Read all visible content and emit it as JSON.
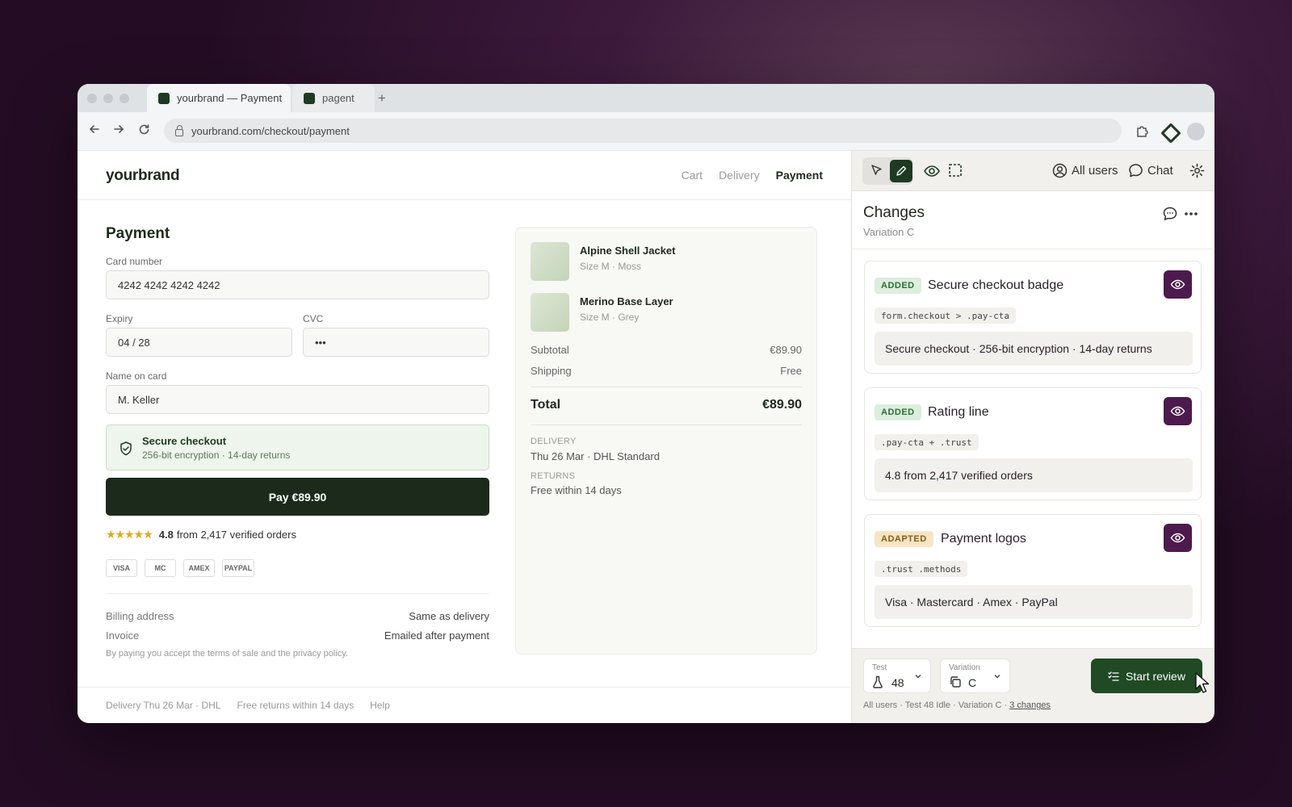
{
  "browser": {
    "tabs": [
      {
        "label": "yourbrand — Payment"
      },
      {
        "label": "pagent"
      }
    ],
    "new_tab": "+",
    "url": "yourbrand.com/checkout/payment"
  },
  "store": {
    "logo": "yourbrand",
    "steps": [
      "Cart",
      "Delivery",
      "Payment"
    ],
    "page_title": "Payment",
    "card_number_label": "Card number",
    "card_number_value": "4242 4242 4242 4242",
    "expiry_label": "Expiry",
    "expiry_value": "04 / 28",
    "cvc_label": "CVC",
    "cvc_value": "•••",
    "name_label": "Name on card",
    "name_value": "M. Keller",
    "secure_title": "Secure checkout",
    "secure_sub": "256-bit encryption · 14-day returns",
    "pay_button": "Pay €89.90",
    "rating_stars": "★★★★★",
    "rating_value": "4.8",
    "rating_text": "from 2,417 verified orders",
    "pay_logos": [
      "VISA",
      "MC",
      "AMEX",
      "PAYPAL"
    ],
    "billing_label": "Billing address",
    "billing_value": "Same as delivery",
    "invoice_label": "Invoice",
    "invoice_value": "Emailed after payment",
    "terms": "By paying you accept the terms of sale and the privacy policy.",
    "footer_links": [
      "Delivery Thu 26 Mar · DHL",
      "Free returns within 14 days",
      "Help"
    ]
  },
  "summary": {
    "items": [
      {
        "name": "Alpine Shell Jacket",
        "sub": "Size M · Moss"
      },
      {
        "name": "Merino Base Layer",
        "sub": "Size M · Grey"
      }
    ],
    "subtotal_label": "Subtotal",
    "subtotal_value": "€89.90",
    "shipping_label": "Shipping",
    "shipping_value": "Free",
    "total_label": "Total",
    "total_value": "€89.90",
    "delivery_cap": "DELIVERY",
    "delivery_value": "Thu 26 Mar · DHL Standard",
    "returns_cap": "RETURNS",
    "returns_value": "Free within 14 days"
  },
  "panel": {
    "audience": "All users",
    "chat": "Chat",
    "title": "Changes",
    "subtitle": "Variation C",
    "changes": [
      {
        "badge": "ADDED",
        "title": "Secure checkout badge",
        "selector": "form.checkout > .pay-cta",
        "text": "Secure checkout · 256-bit encryption · 14-day returns"
      },
      {
        "badge": "ADDED",
        "title": "Rating line",
        "selector": ".pay-cta + .trust",
        "text": "4.8 from 2,417 verified orders"
      },
      {
        "badge": "ADAPTED",
        "title": "Payment logos",
        "selector": ".trust .methods",
        "text": "Visa · Mastercard · Amex · PayPal"
      }
    ],
    "test_label": "Test",
    "test_value": "48",
    "variation_label": "Variation",
    "variation_value": "C",
    "review_button": "Start review",
    "status_text": "All users · Test 48 Idle · Variation C · ",
    "status_link": "3 changes"
  },
  "colors": {
    "brand_dark": "#1b2a1b",
    "panel_accent": "#4c1a4c",
    "review_green": "#1f4a24",
    "star": "#e3a81b"
  }
}
